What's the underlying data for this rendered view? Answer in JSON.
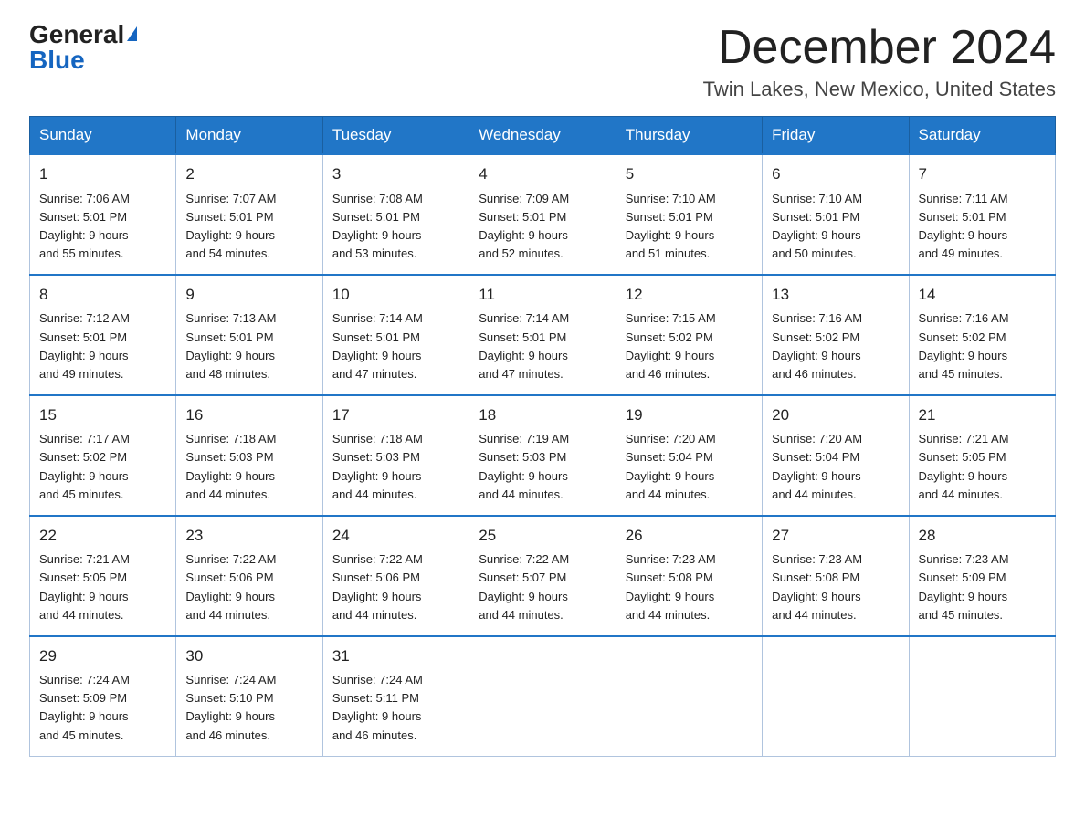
{
  "header": {
    "logo_general": "General",
    "logo_triangle": "▶",
    "logo_blue": "Blue",
    "month_title": "December 2024",
    "location": "Twin Lakes, New Mexico, United States"
  },
  "weekdays": [
    "Sunday",
    "Monday",
    "Tuesday",
    "Wednesday",
    "Thursday",
    "Friday",
    "Saturday"
  ],
  "weeks": [
    [
      {
        "day": "1",
        "sunrise": "7:06 AM",
        "sunset": "5:01 PM",
        "daylight": "9 hours and 55 minutes."
      },
      {
        "day": "2",
        "sunrise": "7:07 AM",
        "sunset": "5:01 PM",
        "daylight": "9 hours and 54 minutes."
      },
      {
        "day": "3",
        "sunrise": "7:08 AM",
        "sunset": "5:01 PM",
        "daylight": "9 hours and 53 minutes."
      },
      {
        "day": "4",
        "sunrise": "7:09 AM",
        "sunset": "5:01 PM",
        "daylight": "9 hours and 52 minutes."
      },
      {
        "day": "5",
        "sunrise": "7:10 AM",
        "sunset": "5:01 PM",
        "daylight": "9 hours and 51 minutes."
      },
      {
        "day": "6",
        "sunrise": "7:10 AM",
        "sunset": "5:01 PM",
        "daylight": "9 hours and 50 minutes."
      },
      {
        "day": "7",
        "sunrise": "7:11 AM",
        "sunset": "5:01 PM",
        "daylight": "9 hours and 49 minutes."
      }
    ],
    [
      {
        "day": "8",
        "sunrise": "7:12 AM",
        "sunset": "5:01 PM",
        "daylight": "9 hours and 49 minutes."
      },
      {
        "day": "9",
        "sunrise": "7:13 AM",
        "sunset": "5:01 PM",
        "daylight": "9 hours and 48 minutes."
      },
      {
        "day": "10",
        "sunrise": "7:14 AM",
        "sunset": "5:01 PM",
        "daylight": "9 hours and 47 minutes."
      },
      {
        "day": "11",
        "sunrise": "7:14 AM",
        "sunset": "5:01 PM",
        "daylight": "9 hours and 47 minutes."
      },
      {
        "day": "12",
        "sunrise": "7:15 AM",
        "sunset": "5:02 PM",
        "daylight": "9 hours and 46 minutes."
      },
      {
        "day": "13",
        "sunrise": "7:16 AM",
        "sunset": "5:02 PM",
        "daylight": "9 hours and 46 minutes."
      },
      {
        "day": "14",
        "sunrise": "7:16 AM",
        "sunset": "5:02 PM",
        "daylight": "9 hours and 45 minutes."
      }
    ],
    [
      {
        "day": "15",
        "sunrise": "7:17 AM",
        "sunset": "5:02 PM",
        "daylight": "9 hours and 45 minutes."
      },
      {
        "day": "16",
        "sunrise": "7:18 AM",
        "sunset": "5:03 PM",
        "daylight": "9 hours and 44 minutes."
      },
      {
        "day": "17",
        "sunrise": "7:18 AM",
        "sunset": "5:03 PM",
        "daylight": "9 hours and 44 minutes."
      },
      {
        "day": "18",
        "sunrise": "7:19 AM",
        "sunset": "5:03 PM",
        "daylight": "9 hours and 44 minutes."
      },
      {
        "day": "19",
        "sunrise": "7:20 AM",
        "sunset": "5:04 PM",
        "daylight": "9 hours and 44 minutes."
      },
      {
        "day": "20",
        "sunrise": "7:20 AM",
        "sunset": "5:04 PM",
        "daylight": "9 hours and 44 minutes."
      },
      {
        "day": "21",
        "sunrise": "7:21 AM",
        "sunset": "5:05 PM",
        "daylight": "9 hours and 44 minutes."
      }
    ],
    [
      {
        "day": "22",
        "sunrise": "7:21 AM",
        "sunset": "5:05 PM",
        "daylight": "9 hours and 44 minutes."
      },
      {
        "day": "23",
        "sunrise": "7:22 AM",
        "sunset": "5:06 PM",
        "daylight": "9 hours and 44 minutes."
      },
      {
        "day": "24",
        "sunrise": "7:22 AM",
        "sunset": "5:06 PM",
        "daylight": "9 hours and 44 minutes."
      },
      {
        "day": "25",
        "sunrise": "7:22 AM",
        "sunset": "5:07 PM",
        "daylight": "9 hours and 44 minutes."
      },
      {
        "day": "26",
        "sunrise": "7:23 AM",
        "sunset": "5:08 PM",
        "daylight": "9 hours and 44 minutes."
      },
      {
        "day": "27",
        "sunrise": "7:23 AM",
        "sunset": "5:08 PM",
        "daylight": "9 hours and 44 minutes."
      },
      {
        "day": "28",
        "sunrise": "7:23 AM",
        "sunset": "5:09 PM",
        "daylight": "9 hours and 45 minutes."
      }
    ],
    [
      {
        "day": "29",
        "sunrise": "7:24 AM",
        "sunset": "5:09 PM",
        "daylight": "9 hours and 45 minutes."
      },
      {
        "day": "30",
        "sunrise": "7:24 AM",
        "sunset": "5:10 PM",
        "daylight": "9 hours and 46 minutes."
      },
      {
        "day": "31",
        "sunrise": "7:24 AM",
        "sunset": "5:11 PM",
        "daylight": "9 hours and 46 minutes."
      },
      null,
      null,
      null,
      null
    ]
  ],
  "labels": {
    "sunrise": "Sunrise:",
    "sunset": "Sunset:",
    "daylight": "Daylight:"
  }
}
